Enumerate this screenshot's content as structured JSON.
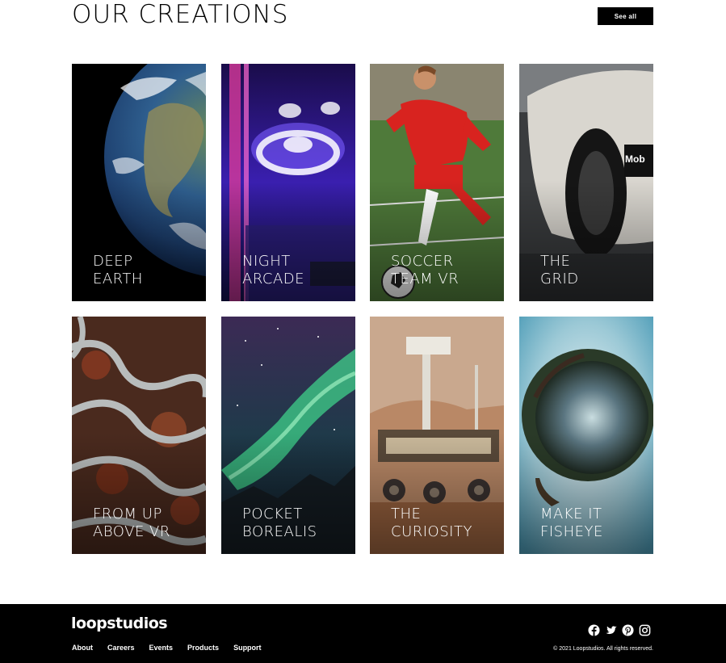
{
  "header": {
    "title": "OUR CREATIONS",
    "see_all_label": "See all"
  },
  "creations": [
    {
      "title_line1": "DEEP",
      "title_line2": "EARTH",
      "image": "earth-from-space"
    },
    {
      "title_line1": "NIGHT",
      "title_line2": "ARCADE",
      "image": "skee-ball-arcade"
    },
    {
      "title_line1": "SOCCER",
      "title_line2": "TEAM VR",
      "image": "soccer-player"
    },
    {
      "title_line1": "THE",
      "title_line2": "GRID",
      "image": "race-car"
    },
    {
      "title_line1": "FROM UP",
      "title_line2": "ABOVE VR",
      "image": "winding-roads-aerial"
    },
    {
      "title_line1": "POCKET",
      "title_line2": "BOREALIS",
      "image": "aurora-borealis"
    },
    {
      "title_line1": "THE",
      "title_line2": "CURIOSITY",
      "image": "mars-rover"
    },
    {
      "title_line1": "MAKE IT",
      "title_line2": "FISHEYE",
      "image": "fisheye-planet"
    }
  ],
  "footer": {
    "logo": "loopstudios",
    "nav": [
      "About",
      "Careers",
      "Events",
      "Products",
      "Support"
    ],
    "social_icons": [
      "facebook-icon",
      "twitter-icon",
      "pinterest-icon",
      "instagram-icon"
    ],
    "copyright": "© 2021 Loopstudios. All rights reserved."
  }
}
